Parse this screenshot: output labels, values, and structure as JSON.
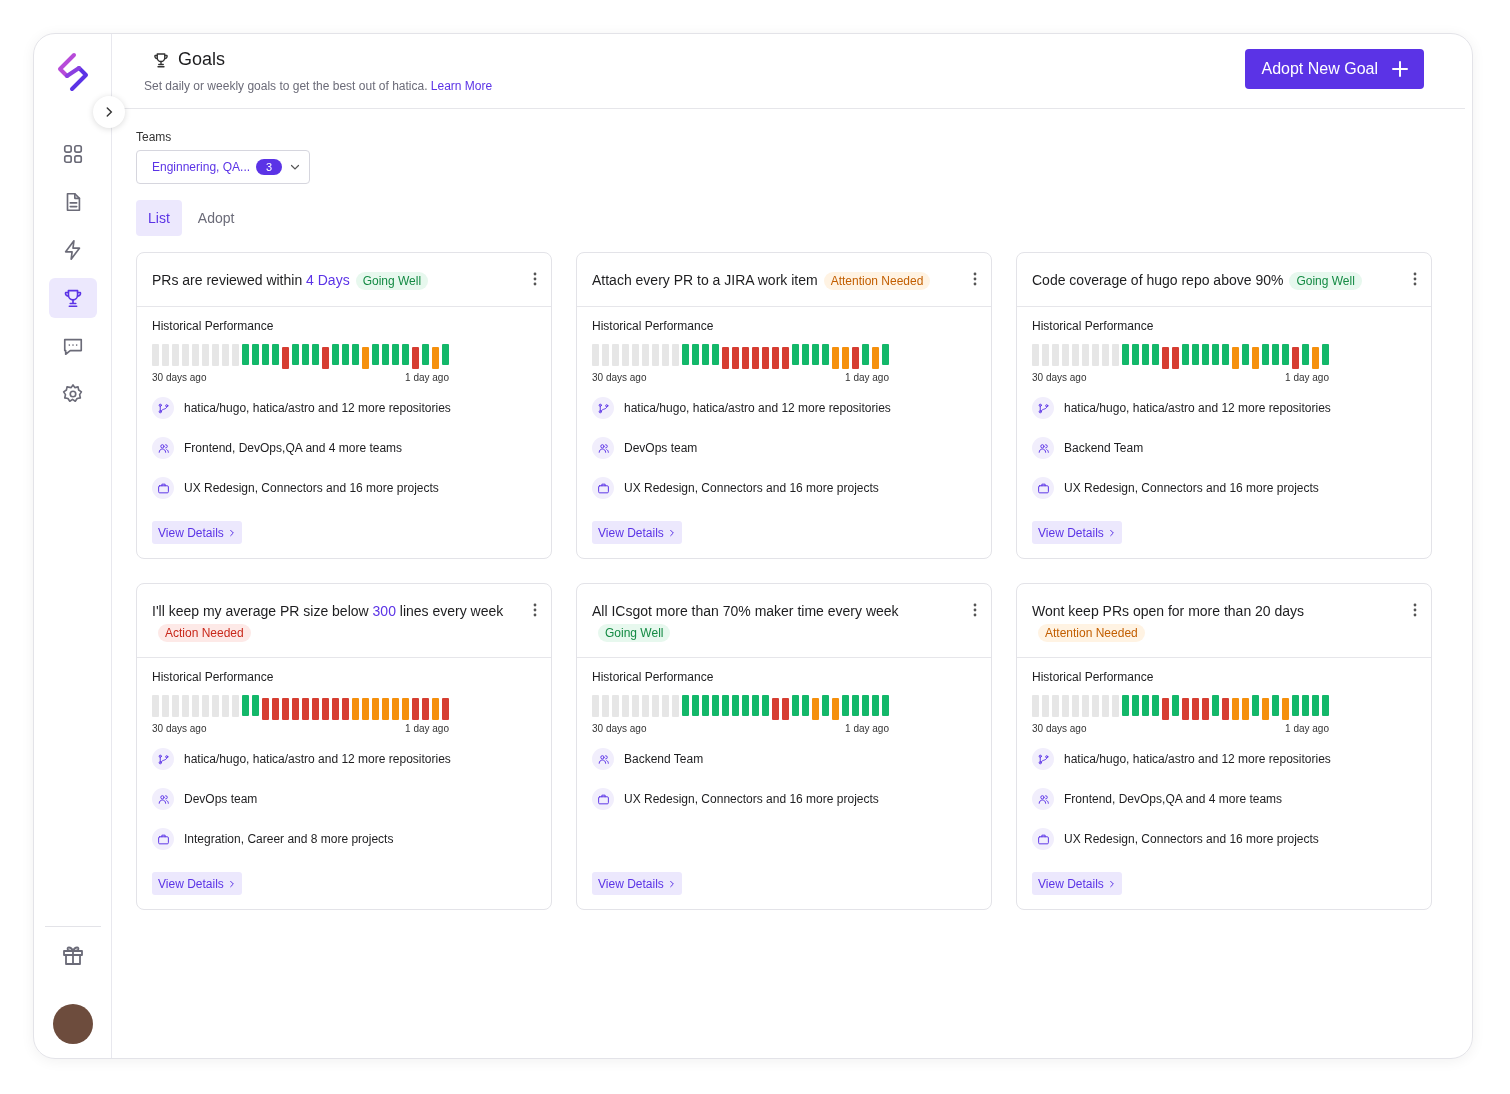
{
  "sidebar": {
    "items": [
      {
        "selected": false
      },
      {
        "selected": false
      },
      {
        "selected": false
      },
      {
        "selected": true
      },
      {
        "selected": false
      },
      {
        "selected": false
      }
    ]
  },
  "header": {
    "title": "Goals",
    "subtitle": "Set daily or weekly goals to get the best out of hatica.",
    "link": "Learn More",
    "button": "Adopt New Goal"
  },
  "teams": {
    "label": "Teams",
    "value": "Enginnering, QA...",
    "count": "3"
  },
  "tabs": [
    {
      "label": "List",
      "selected": true
    },
    {
      "label": "Adopt",
      "selected": false
    }
  ],
  "cards": [
    {
      "title": [
        {
          "text": "PRs are reviewed within ",
          "highlight": false
        },
        {
          "text": "4 Days",
          "highlight": true
        }
      ],
      "status": {
        "label": "Going Well",
        "kind": "good"
      },
      "history_label": "Historical Performance",
      "history": [
        {
          "kind": "n"
        },
        {
          "kind": "n"
        },
        {
          "kind": "n"
        },
        {
          "kind": "n"
        },
        {
          "kind": "n"
        },
        {
          "kind": "n"
        },
        {
          "kind": "n"
        },
        {
          "kind": "n"
        },
        {
          "kind": "n"
        },
        {
          "kind": "g"
        },
        {
          "kind": "g"
        },
        {
          "kind": "g"
        },
        {
          "kind": "g"
        },
        {
          "kind": "r"
        },
        {
          "kind": "g"
        },
        {
          "kind": "g"
        },
        {
          "kind": "g"
        },
        {
          "kind": "r"
        },
        {
          "kind": "g"
        },
        {
          "kind": "g"
        },
        {
          "kind": "g"
        },
        {
          "kind": "a"
        },
        {
          "kind": "g"
        },
        {
          "kind": "g"
        },
        {
          "kind": "g"
        },
        {
          "kind": "g"
        },
        {
          "kind": "r"
        },
        {
          "kind": "g"
        },
        {
          "kind": "a"
        },
        {
          "kind": "g"
        }
      ],
      "axis": [
        "30 days ago",
        "1 day ago"
      ],
      "details": [
        {
          "kind": "repos",
          "text": "hatica/hugo, hatica/astro and 12 more repositories"
        },
        {
          "kind": "teams",
          "text": "Frontend, DevOps,QA and 4 more teams"
        },
        {
          "kind": "projects",
          "text": "UX Redesign, Connectors and 16 more projects"
        }
      ],
      "action": "View Details"
    },
    {
      "title": [
        {
          "text": "Attach every PR to a JIRA work item",
          "highlight": false
        }
      ],
      "status": {
        "label": "Attention Needed",
        "kind": "attention"
      },
      "history_label": "Historical Performance",
      "history": [
        {
          "kind": "n"
        },
        {
          "kind": "n"
        },
        {
          "kind": "n"
        },
        {
          "kind": "n"
        },
        {
          "kind": "n"
        },
        {
          "kind": "n"
        },
        {
          "kind": "n"
        },
        {
          "kind": "n"
        },
        {
          "kind": "n"
        },
        {
          "kind": "g"
        },
        {
          "kind": "g"
        },
        {
          "kind": "g"
        },
        {
          "kind": "g"
        },
        {
          "kind": "r"
        },
        {
          "kind": "r"
        },
        {
          "kind": "r"
        },
        {
          "kind": "r"
        },
        {
          "kind": "r"
        },
        {
          "kind": "r"
        },
        {
          "kind": "r"
        },
        {
          "kind": "g"
        },
        {
          "kind": "g"
        },
        {
          "kind": "g"
        },
        {
          "kind": "g"
        },
        {
          "kind": "a"
        },
        {
          "kind": "a"
        },
        {
          "kind": "r"
        },
        {
          "kind": "g"
        },
        {
          "kind": "a"
        },
        {
          "kind": "g"
        }
      ],
      "axis": [
        "30 days ago",
        "1 day ago"
      ],
      "details": [
        {
          "kind": "repos",
          "text": "hatica/hugo, hatica/astro and 12 more repositories"
        },
        {
          "kind": "teams",
          "text": "DevOps team"
        },
        {
          "kind": "projects",
          "text": "UX Redesign, Connectors and 16 more projects"
        }
      ],
      "action": "View Details"
    },
    {
      "title": [
        {
          "text": "Code coverage of hugo repo above 90%",
          "highlight": false
        }
      ],
      "status": {
        "label": "Going Well",
        "kind": "good"
      },
      "history_label": "Historical Performance",
      "history": [
        {
          "kind": "n"
        },
        {
          "kind": "n"
        },
        {
          "kind": "n"
        },
        {
          "kind": "n"
        },
        {
          "kind": "n"
        },
        {
          "kind": "n"
        },
        {
          "kind": "n"
        },
        {
          "kind": "n"
        },
        {
          "kind": "n"
        },
        {
          "kind": "g"
        },
        {
          "kind": "g"
        },
        {
          "kind": "g"
        },
        {
          "kind": "g"
        },
        {
          "kind": "r"
        },
        {
          "kind": "r"
        },
        {
          "kind": "g"
        },
        {
          "kind": "g"
        },
        {
          "kind": "g"
        },
        {
          "kind": "g"
        },
        {
          "kind": "g"
        },
        {
          "kind": "a"
        },
        {
          "kind": "g"
        },
        {
          "kind": "a"
        },
        {
          "kind": "g"
        },
        {
          "kind": "g"
        },
        {
          "kind": "g"
        },
        {
          "kind": "r"
        },
        {
          "kind": "g"
        },
        {
          "kind": "a"
        },
        {
          "kind": "g"
        }
      ],
      "axis": [
        "30 days ago",
        "1 day ago"
      ],
      "details": [
        {
          "kind": "repos",
          "text": "hatica/hugo, hatica/astro and 12 more repositories"
        },
        {
          "kind": "teams",
          "text": "Backend Team"
        },
        {
          "kind": "projects",
          "text": "UX Redesign, Connectors and 16 more projects"
        }
      ],
      "action": "View Details"
    },
    {
      "title": [
        {
          "text": "I'll keep my average PR size below ",
          "highlight": false
        },
        {
          "text": "300",
          "highlight": true
        },
        {
          "text": " lines every week",
          "highlight": false
        }
      ],
      "status": {
        "label": "Action Needed",
        "kind": "action"
      },
      "history_label": "Historical Performance",
      "history": [
        {
          "kind": "n"
        },
        {
          "kind": "n"
        },
        {
          "kind": "n"
        },
        {
          "kind": "n"
        },
        {
          "kind": "n"
        },
        {
          "kind": "n"
        },
        {
          "kind": "n"
        },
        {
          "kind": "n"
        },
        {
          "kind": "n"
        },
        {
          "kind": "g"
        },
        {
          "kind": "g"
        },
        {
          "kind": "r"
        },
        {
          "kind": "r"
        },
        {
          "kind": "r"
        },
        {
          "kind": "r"
        },
        {
          "kind": "r"
        },
        {
          "kind": "r"
        },
        {
          "kind": "r"
        },
        {
          "kind": "r"
        },
        {
          "kind": "r"
        },
        {
          "kind": "a"
        },
        {
          "kind": "a"
        },
        {
          "kind": "a"
        },
        {
          "kind": "a"
        },
        {
          "kind": "a"
        },
        {
          "kind": "a"
        },
        {
          "kind": "r"
        },
        {
          "kind": "r"
        },
        {
          "kind": "a"
        },
        {
          "kind": "r"
        }
      ],
      "axis": [
        "30 days ago",
        "1 day ago"
      ],
      "details": [
        {
          "kind": "repos",
          "text": "hatica/hugo, hatica/astro and 12 more repositories"
        },
        {
          "kind": "teams",
          "text": "DevOps team"
        },
        {
          "kind": "projects",
          "text": "Integration, Career and 8 more projects"
        }
      ],
      "action": "View Details"
    },
    {
      "title": [
        {
          "text": "All ICsgot more than 70% maker time every week",
          "highlight": false
        }
      ],
      "status": {
        "label": "Going Well",
        "kind": "good"
      },
      "history_label": "Historical Performance",
      "history": [
        {
          "kind": "n"
        },
        {
          "kind": "n"
        },
        {
          "kind": "n"
        },
        {
          "kind": "n"
        },
        {
          "kind": "n"
        },
        {
          "kind": "n"
        },
        {
          "kind": "n"
        },
        {
          "kind": "n"
        },
        {
          "kind": "n"
        },
        {
          "kind": "g"
        },
        {
          "kind": "g"
        },
        {
          "kind": "g"
        },
        {
          "kind": "g"
        },
        {
          "kind": "g"
        },
        {
          "kind": "g"
        },
        {
          "kind": "g"
        },
        {
          "kind": "g"
        },
        {
          "kind": "g"
        },
        {
          "kind": "r"
        },
        {
          "kind": "r"
        },
        {
          "kind": "g"
        },
        {
          "kind": "g"
        },
        {
          "kind": "a"
        },
        {
          "kind": "g"
        },
        {
          "kind": "a"
        },
        {
          "kind": "g"
        },
        {
          "kind": "g"
        },
        {
          "kind": "g"
        },
        {
          "kind": "g"
        },
        {
          "kind": "g"
        }
      ],
      "axis": [
        "30 days ago",
        "1 day ago"
      ],
      "details": [
        {
          "kind": "teams",
          "text": "Backend Team"
        },
        {
          "kind": "projects",
          "text": "UX Redesign, Connectors and 16 more projects"
        }
      ],
      "action": "View Details"
    },
    {
      "title": [
        {
          "text": "Wont keep PRs open for more than 20 days",
          "highlight": false
        }
      ],
      "status": {
        "label": "Attention Needed",
        "kind": "attention"
      },
      "history_label": "Historical Performance",
      "history": [
        {
          "kind": "n"
        },
        {
          "kind": "n"
        },
        {
          "kind": "n"
        },
        {
          "kind": "n"
        },
        {
          "kind": "n"
        },
        {
          "kind": "n"
        },
        {
          "kind": "n"
        },
        {
          "kind": "n"
        },
        {
          "kind": "n"
        },
        {
          "kind": "g"
        },
        {
          "kind": "g"
        },
        {
          "kind": "g"
        },
        {
          "kind": "g"
        },
        {
          "kind": "r"
        },
        {
          "kind": "g"
        },
        {
          "kind": "r"
        },
        {
          "kind": "r"
        },
        {
          "kind": "r"
        },
        {
          "kind": "g"
        },
        {
          "kind": "r"
        },
        {
          "kind": "a"
        },
        {
          "kind": "a"
        },
        {
          "kind": "g"
        },
        {
          "kind": "a"
        },
        {
          "kind": "g"
        },
        {
          "kind": "a"
        },
        {
          "kind": "g"
        },
        {
          "kind": "g"
        },
        {
          "kind": "g"
        },
        {
          "kind": "g"
        }
      ],
      "axis": [
        "30 days ago",
        "1 day ago"
      ],
      "details": [
        {
          "kind": "repos",
          "text": "hatica/hugo, hatica/astro and 12 more repositories"
        },
        {
          "kind": "teams",
          "text": "Frontend, DevOps,QA and 4 more teams"
        },
        {
          "kind": "projects",
          "text": "UX Redesign, Connectors and 16 more projects"
        }
      ],
      "action": "View Details"
    }
  ]
}
